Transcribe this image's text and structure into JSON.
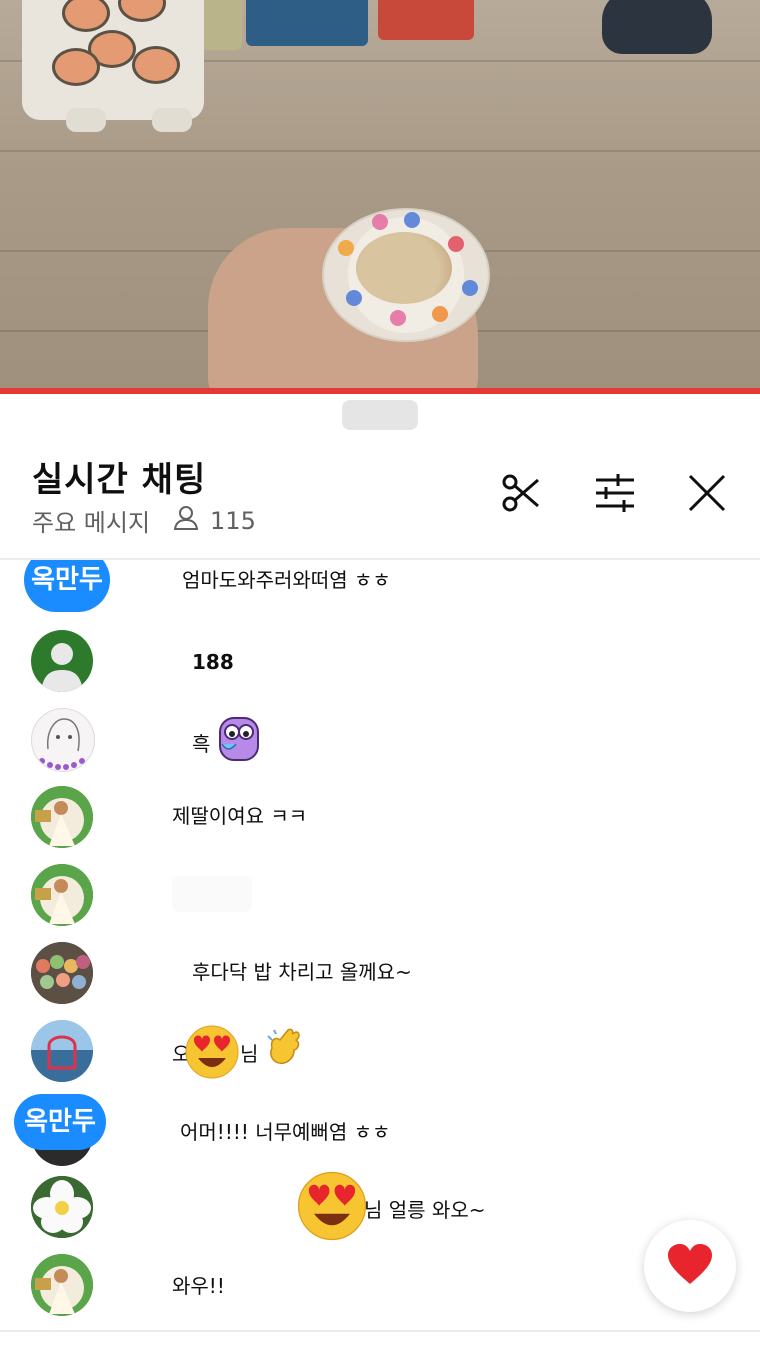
{
  "chat_panel": {
    "title": "실시간 채팅",
    "mode_label": "주요 메시지",
    "viewer_count": "115",
    "icons": [
      "scissors-icon",
      "tune-icon",
      "close-icon"
    ]
  },
  "messages": [
    {
      "text": "엄마도와주러와떠염 ㅎㅎ",
      "badge": "옥만두"
    },
    {
      "text": "188"
    },
    {
      "text": "흑"
    },
    {
      "text": "제딸이여요 ㅋㅋ"
    },
    {
      "text": ""
    },
    {
      "text": "후다닥 밥 차리고 올께요~"
    },
    {
      "text_start": "오",
      "text_end": "님"
    },
    {
      "text": "어머!!!! 너무예뻐염 ㅎㅎ",
      "badge": "옥만두"
    },
    {
      "text": "님 얼릉 와오~"
    },
    {
      "text": "와우!!"
    }
  ],
  "colors": {
    "accent_red": "#e53935",
    "badge_blue": "#1a8cff",
    "heart": "#e8242c"
  }
}
